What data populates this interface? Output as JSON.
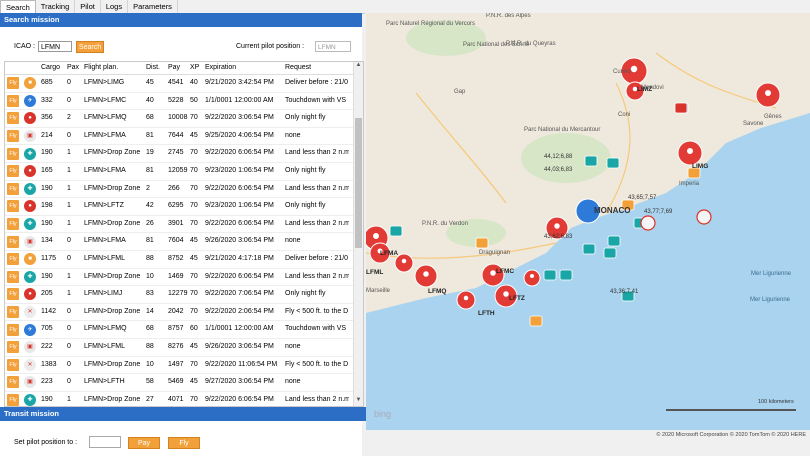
{
  "tabs": [
    "Search",
    "Tracking",
    "Pilot",
    "Logs",
    "Parameters"
  ],
  "search_panel": {
    "title": "Search mission",
    "icao_label": "ICAO :",
    "icao_value": "LFMN",
    "search_button": "Search",
    "pilot_position_label": "Current pilot position :",
    "pilot_position_placeholder": "LFMN"
  },
  "grid": {
    "columns": [
      "Cargo",
      "Pax",
      "Flight plan.",
      "Dist.",
      "Pay",
      "XP",
      "Expiration",
      "Request"
    ],
    "fly_label": "Fly",
    "rows": [
      {
        "icon": "orange-crate",
        "cargo": "685",
        "pax": "0",
        "plan": "LFMN>LIMG",
        "dist": "45",
        "pay": "4541",
        "xp": "40",
        "exp": "9/21/2020 3:42:54 PM",
        "req": "Deliver before : 21/0"
      },
      {
        "icon": "blue-helicopter",
        "cargo": "332",
        "pax": "0",
        "plan": "LFMN>LFMC",
        "dist": "40",
        "pay": "5228",
        "xp": "50",
        "exp": "1/1/0001 12:00:00 AM",
        "req": "Touchdown with VS"
      },
      {
        "icon": "red-pilot",
        "cargo": "356",
        "pax": "2",
        "plan": "LFMN>LFMQ",
        "dist": "68",
        "pay": "10008",
        "xp": "70",
        "exp": "9/22/2020 3:06:54 PM",
        "req": "Only night fly"
      },
      {
        "icon": "red-box",
        "cargo": "214",
        "pax": "0",
        "plan": "LFMN>LFMA",
        "dist": "81",
        "pay": "7644",
        "xp": "45",
        "exp": "9/25/2020 4:06:54 PM",
        "req": "none"
      },
      {
        "icon": "teal-medic",
        "cargo": "190",
        "pax": "1",
        "plan": "LFMN>Drop Zone",
        "dist": "19",
        "pay": "2745",
        "xp": "70",
        "exp": "9/22/2020 6:06:54 PM",
        "req": "Land less than 2 n.m"
      },
      {
        "icon": "red-pilot",
        "cargo": "165",
        "pax": "1",
        "plan": "LFMN>LFMA",
        "dist": "81",
        "pay": "12059",
        "xp": "70",
        "exp": "9/23/2020 1:06:54 PM",
        "req": "Only night fly"
      },
      {
        "icon": "teal-medic",
        "cargo": "190",
        "pax": "1",
        "plan": "LFMN>Drop Zone",
        "dist": "2",
        "pay": "266",
        "xp": "70",
        "exp": "9/22/2020 6:06:54 PM",
        "req": "Land less than 2 n.m"
      },
      {
        "icon": "red-pilot",
        "cargo": "198",
        "pax": "1",
        "plan": "LFMN>LFTZ",
        "dist": "42",
        "pay": "6295",
        "xp": "70",
        "exp": "9/23/2020 1:06:54 PM",
        "req": "Only night fly"
      },
      {
        "icon": "teal-medic",
        "cargo": "190",
        "pax": "1",
        "plan": "LFMN>Drop Zone",
        "dist": "26",
        "pay": "3901",
        "xp": "70",
        "exp": "9/22/2020 6:06:54 PM",
        "req": "Land less than 2 n.m"
      },
      {
        "icon": "red-box",
        "cargo": "134",
        "pax": "0",
        "plan": "LFMN>LFMA",
        "dist": "81",
        "pay": "7604",
        "xp": "45",
        "exp": "9/26/2020 3:06:54 PM",
        "req": "none"
      },
      {
        "icon": "orange-crate",
        "cargo": "1175",
        "pax": "0",
        "plan": "LFMN>LFML",
        "dist": "88",
        "pay": "8752",
        "xp": "45",
        "exp": "9/21/2020 4:17:18 PM",
        "req": "Deliver before : 21/0"
      },
      {
        "icon": "teal-medic",
        "cargo": "190",
        "pax": "1",
        "plan": "LFMN>Drop Zone",
        "dist": "10",
        "pay": "1469",
        "xp": "70",
        "exp": "9/22/2020 6:06:54 PM",
        "req": "Land less than 2 n.m"
      },
      {
        "icon": "red-pilot",
        "cargo": "205",
        "pax": "1",
        "plan": "LFMN>LIMJ",
        "dist": "83",
        "pay": "12279",
        "xp": "70",
        "exp": "9/22/2020 7:06:54 PM",
        "req": "Only night fly"
      },
      {
        "icon": "fire-drop",
        "cargo": "1142",
        "pax": "0",
        "plan": "LFMN>Drop Zone",
        "dist": "14",
        "pay": "2042",
        "xp": "70",
        "exp": "9/22/2020 2:06:54 PM",
        "req": "Fly < 500 ft. to the D"
      },
      {
        "icon": "blue-helicopter",
        "cargo": "705",
        "pax": "0",
        "plan": "LFMN>LFMQ",
        "dist": "68",
        "pay": "8757",
        "xp": "60",
        "exp": "1/1/0001 12:00:00 AM",
        "req": "Touchdown with VS"
      },
      {
        "icon": "red-box",
        "cargo": "222",
        "pax": "0",
        "plan": "LFMN>LFML",
        "dist": "88",
        "pay": "8276",
        "xp": "45",
        "exp": "9/26/2020 3:06:54 PM",
        "req": "none"
      },
      {
        "icon": "fire-drop",
        "cargo": "1383",
        "pax": "0",
        "plan": "LFMN>Drop Zone",
        "dist": "10",
        "pay": "1497",
        "xp": "70",
        "exp": "9/22/2020 11:06:54 PM",
        "req": "Fly < 500 ft. to the D"
      },
      {
        "icon": "red-box",
        "cargo": "223",
        "pax": "0",
        "plan": "LFMN>LFTH",
        "dist": "58",
        "pay": "5469",
        "xp": "45",
        "exp": "9/27/2020 3:06:54 PM",
        "req": "none"
      },
      {
        "icon": "teal-medic",
        "cargo": "190",
        "pax": "1",
        "plan": "LFMN>Drop Zone",
        "dist": "27",
        "pay": "4071",
        "xp": "70",
        "exp": "9/22/2020 6:06:54 PM",
        "req": "Land less than 2 n.m"
      }
    ]
  },
  "transit_panel": {
    "title": "Transit mission",
    "set_label": "Set pilot position to :",
    "pay_button": "Pay",
    "fly_button": "Fly"
  },
  "map": {
    "places": [
      "Gap",
      "Cuneo",
      "Mondovi",
      "Coni",
      "Savone",
      "Gênes",
      "Imperia",
      "Draguignan",
      "Marseille",
      "MONACO",
      "Mer Ligurienne",
      "P.N.R. du Verdon",
      "Parc National des Écrins",
      "Parc National du Mercantour",
      "P.N.R. du Queyras",
      "P.N.R. des Alpes",
      "Parc Naturel Régional du Vercors",
      "Mer Ligurienne"
    ],
    "airport_labels": [
      "LIMZ",
      "LIMG",
      "LFMA",
      "LFML",
      "LFMC",
      "LFMQ",
      "LFTZ",
      "LFTH"
    ],
    "coord_labels": [
      "44,12;6,88",
      "44,03;6,83",
      "43,65;7,57",
      "43,77;7,69",
      "43,62;6,83",
      "43,36;7,41"
    ],
    "scale_label": "100 kilometers",
    "attribution": "© 2020 Microsoft Corporation   © 2020 TomTom © 2020 HERE",
    "logo": "bing",
    "colors": {
      "marker_red": "#e23a35",
      "marker_blue": "#2d7ad8",
      "sea": "#a9d3ee",
      "land": "#efe9dd",
      "accent": "#f2a03a",
      "header": "#2c6ec6"
    }
  }
}
